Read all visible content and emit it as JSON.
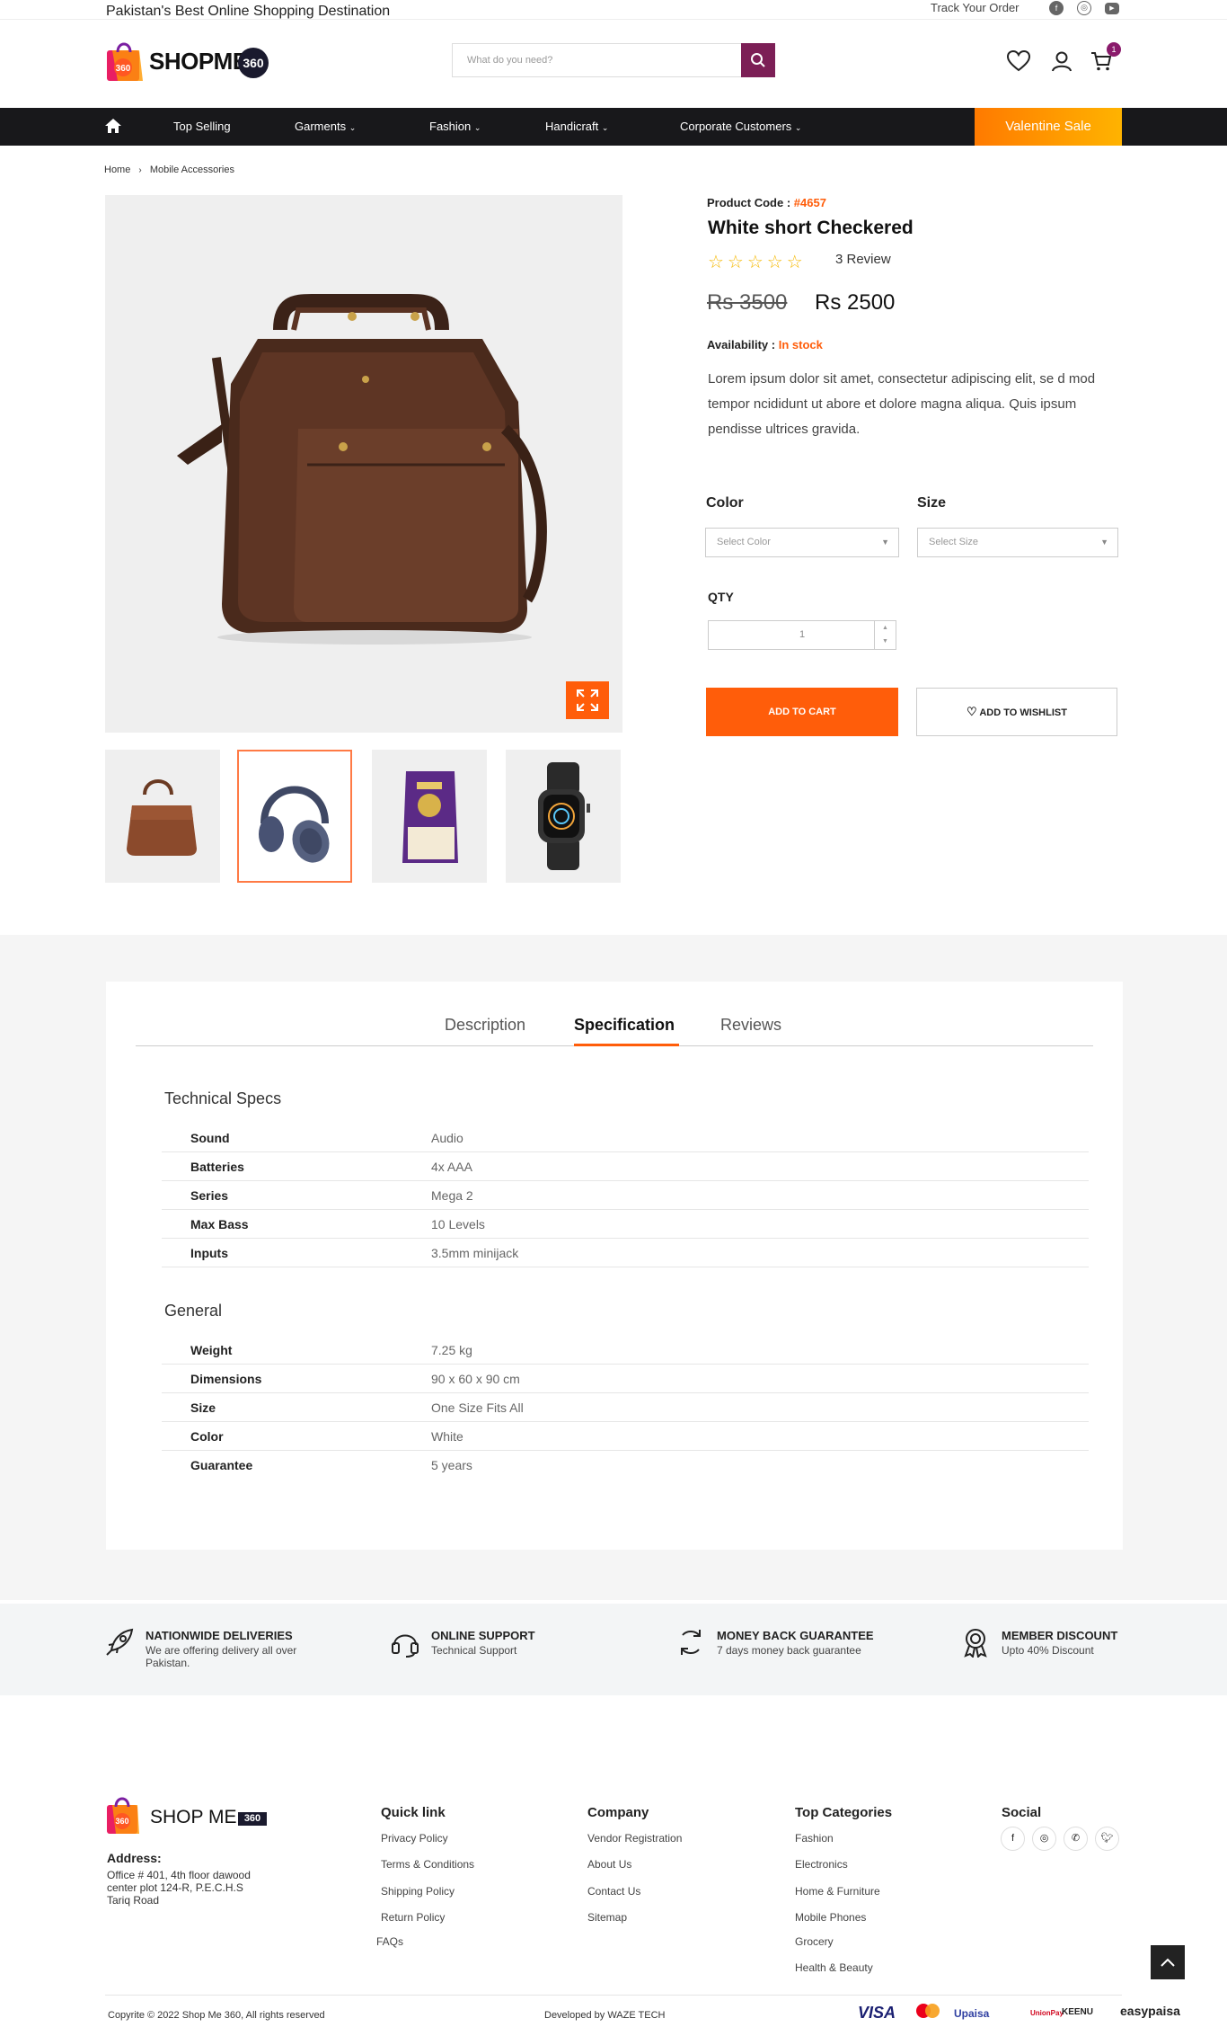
{
  "topbar": {
    "tagline": "Pakistan's Best Online Shopping Destination",
    "track_order": "Track Your Order"
  },
  "header": {
    "logo_text": "SHOPME",
    "logo_badge": "360",
    "search_placeholder": "What do you need?",
    "cart_count": "1"
  },
  "nav": {
    "items": [
      "Top Selling",
      "Garments",
      "Fashion",
      "Handicraft",
      "Corporate Customers"
    ],
    "sale": "Valentine Sale"
  },
  "breadcrumb": [
    "Home",
    "Mobile Accessories"
  ],
  "product": {
    "code_label": "Product Code :",
    "code": "#4657",
    "title": "White short Checkered",
    "reviews": "3 Review",
    "old_price": "Rs 3500",
    "price": "Rs 2500",
    "availability_label": "Availability :",
    "availability": "In stock",
    "description": "Lorem ipsum dolor sit amet, consectetur adipiscing elit, se d mod tempor ncididunt ut abore et dolore magna aliqua. Quis ipsum pendisse ultrices gravida.",
    "color_label": "Color",
    "color_placeholder": "Select Color",
    "size_label": "Size",
    "size_placeholder": "Select Size",
    "qty_label": "QTY",
    "qty": "1",
    "add_to_cart": "ADD TO CART",
    "add_to_wishlist": "ADD TO WISHLIST"
  },
  "tabs": [
    "Description",
    "Specification",
    "Reviews"
  ],
  "specs": {
    "technical_title": "Technical Specs",
    "technical": [
      [
        "Sound",
        "Audio"
      ],
      [
        "Batteries",
        "4x AAA"
      ],
      [
        "Series",
        "Mega 2"
      ],
      [
        "Max Bass",
        "10 Levels"
      ],
      [
        "Inputs",
        "3.5mm minijack"
      ]
    ],
    "general_title": "General",
    "general": [
      [
        "Weight",
        "7.25 kg"
      ],
      [
        "Dimensions",
        "90 x 60 x 90 cm"
      ],
      [
        "Size",
        "One Size Fits All"
      ],
      [
        "Color",
        "White"
      ],
      [
        "Guarantee",
        "5 years"
      ]
    ]
  },
  "features": [
    {
      "title": "NATIONWIDE DELIVERIES",
      "sub": "We are offering delivery all over Pakistan."
    },
    {
      "title": "ONLINE SUPPORT",
      "sub": "Technical Support"
    },
    {
      "title": "MONEY BACK GUARANTEE",
      "sub": "7 days money back guarantee"
    },
    {
      "title": "MEMBER DISCOUNT",
      "sub": "Upto 40% Discount"
    }
  ],
  "footer": {
    "logo_text": "SHOP ME",
    "logo_badge": "360",
    "address_title": "Address:",
    "address": "Office # 401, 4th floor dawood center plot 124-R, P.E.C.H.S Tariq Road",
    "quick_title": "Quick link",
    "quick": [
      "Privacy Policy",
      "Terms & Conditions",
      "Shipping Policy",
      "Return Policy",
      "FAQs"
    ],
    "company_title": "Company",
    "company": [
      "Vendor Registration",
      "About Us",
      "Contact Us",
      "Sitemap"
    ],
    "categories_title": "Top Categories",
    "categories": [
      "Fashion",
      "Electronics",
      "Home & Furniture",
      "Mobile Phones",
      "Grocery",
      "Health & Beauty"
    ],
    "social_title": "Social",
    "copyright": "Copyrite © 2022 Shop Me 360, All rights reserved",
    "developer": "Developed by WAZE TECH",
    "payments": [
      "VISA",
      "mastercard",
      "Upaisa",
      "UnionPay",
      "KEENU",
      "easypaisa"
    ]
  },
  "colors": {
    "accent": "#ff5d0a",
    "brand": "#7c1f56",
    "nav_bg": "#18181b"
  }
}
